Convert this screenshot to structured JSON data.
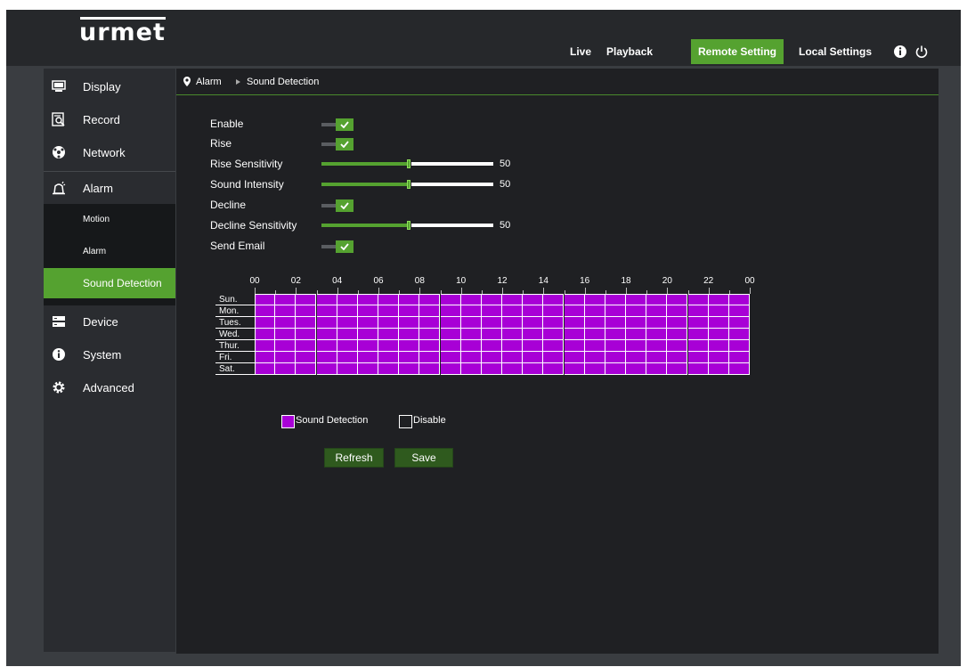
{
  "header": {
    "logo_text": "urmet",
    "nav": [
      {
        "label": "Live",
        "active": false
      },
      {
        "label": "Playback",
        "active": false
      },
      {
        "label": "Remote Setting",
        "active": true
      },
      {
        "label": "Local Settings",
        "active": false
      }
    ],
    "icons": [
      "info-icon",
      "power-icon"
    ]
  },
  "sidebar": {
    "items": [
      {
        "label": "Display",
        "icon": "monitor-icon"
      },
      {
        "label": "Record",
        "icon": "record-icon"
      },
      {
        "label": "Network",
        "icon": "network-icon"
      },
      {
        "label": "Alarm",
        "icon": "alarm-icon"
      },
      {
        "label": "Device",
        "icon": "device-icon"
      },
      {
        "label": "System",
        "icon": "info-icon"
      },
      {
        "label": "Advanced",
        "icon": "gear-icon"
      }
    ],
    "submenu": [
      {
        "label": "Motion",
        "active": false
      },
      {
        "label": "Alarm",
        "active": false
      },
      {
        "label": "Sound Detection",
        "active": true
      }
    ]
  },
  "breadcrumb": {
    "section": "Alarm",
    "page": "Sound Detection"
  },
  "form": {
    "enable": {
      "label": "Enable",
      "checked": true
    },
    "rise": {
      "label": "Rise",
      "checked": true
    },
    "rise_sensitivity": {
      "label": "Rise Sensitivity",
      "value": "50",
      "fraction": 0.5
    },
    "sound_intensity": {
      "label": "Sound Intensity",
      "value": "50",
      "fraction": 0.5
    },
    "decline": {
      "label": "Decline",
      "checked": true
    },
    "decline_sensitivity": {
      "label": "Decline Sensitivity",
      "value": "50",
      "fraction": 0.5
    },
    "send_email": {
      "label": "Send Email",
      "checked": true
    }
  },
  "schedule": {
    "hours": [
      "00",
      "02",
      "04",
      "06",
      "08",
      "10",
      "12",
      "14",
      "16",
      "18",
      "20",
      "22",
      "00"
    ],
    "days": [
      "Sun.",
      "Mon.",
      "Tues.",
      "Wed.",
      "Thur.",
      "Fri.",
      "Sat."
    ],
    "slots_per_day": 24,
    "all_active": true
  },
  "legend": {
    "active_label": "Sound Detection",
    "disable_label": "Disable"
  },
  "buttons": {
    "refresh": "Refresh",
    "save": "Save"
  },
  "colors": {
    "accent_green": "#55a230",
    "schedule_purple": "#a800d6",
    "button_green": "#2f5a1e"
  }
}
